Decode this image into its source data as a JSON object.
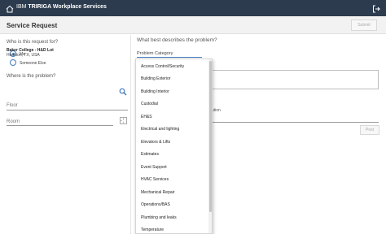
{
  "app": {
    "brand": "IBM",
    "product": "TRIRIGA Workplace Services"
  },
  "header": {
    "title": "Service Request",
    "submit_label": "Submit"
  },
  "requester": {
    "question": "Who is this request for?",
    "options": [
      {
        "label": "Me",
        "selected": true
      },
      {
        "label": "Someone Else",
        "selected": false
      }
    ]
  },
  "location": {
    "question": "Where is the problem?",
    "name": "Baker College - H&D Lot",
    "city": "Houston, TX, USA",
    "floor_label": "Floor",
    "room_label": "Room"
  },
  "problem": {
    "question": "What best describes the problem?",
    "category_placeholder": "Problem Category",
    "partial_label": "ution",
    "post_label": "Post"
  },
  "categories": [
    "Access Control/Security",
    "Building Exterior",
    "Building Interior",
    "Custodial",
    "EH&S",
    "Electrical and lighting",
    "Elevators & Lifts",
    "Estimates",
    "Event Support",
    "HVAC Services",
    "Mechanical Repair",
    "Operations/BAS",
    "Plumbing and leaks",
    "Temperature"
  ],
  "colors": {
    "topbar": "#2d3b4e",
    "accent": "#4178be"
  },
  "icons": {
    "home": "home-icon",
    "exit": "logout-icon",
    "search": "search-icon",
    "room": "floor-plan-icon"
  }
}
